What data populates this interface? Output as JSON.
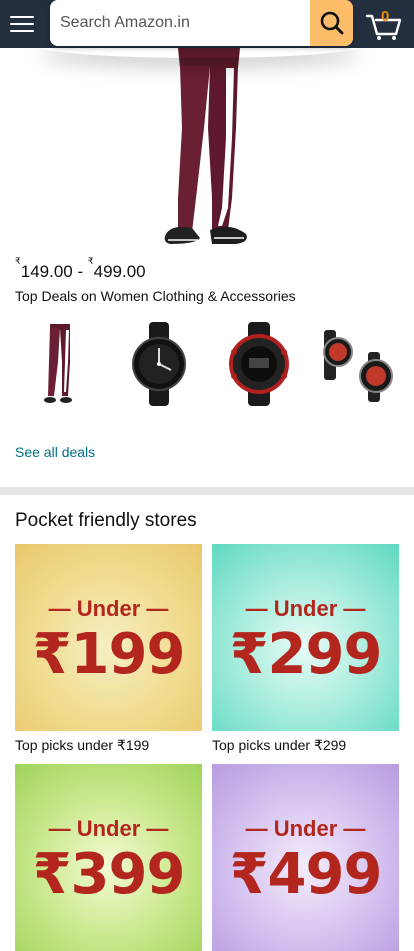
{
  "header": {
    "search_placeholder": "Search Amazon.in",
    "cart_count": "0"
  },
  "deal": {
    "price_symbol_low": "₹",
    "price_low": "149.00",
    "price_separator": "-",
    "price_symbol_high": "₹",
    "price_high": "499.00",
    "title": "Top Deals on Women Clothing & Accessories",
    "see_all": "See all deals"
  },
  "thumbnails": [
    {
      "icon": "leggings-icon"
    },
    {
      "icon": "watch-black-icon"
    },
    {
      "icon": "watch-digital-icon"
    },
    {
      "icon": "watch-pair-icon"
    }
  ],
  "stores": {
    "title": "Pocket friendly stores",
    "items": [
      {
        "banner_label": "— Under —",
        "banner_price": "₹199",
        "caption": "Top picks under ₹199",
        "color_from": "#f6efc4",
        "color_to": "#e9c86b"
      },
      {
        "banner_label": "— Under —",
        "banner_price": "₹299",
        "caption": "Top picks under ₹299",
        "color_from": "#e8fbf6",
        "color_to": "#5fd9c0"
      },
      {
        "banner_label": "— Under —",
        "banner_price": "₹399",
        "caption": "",
        "color_from": "#f3fbd4",
        "color_to": "#9fd35a"
      },
      {
        "banner_label": "— Under —",
        "banner_price": "₹499",
        "caption": "",
        "color_from": "#f4ecfb",
        "color_to": "#b79be0"
      }
    ]
  },
  "colors": {
    "header_bg": "#232f3e",
    "search_button": "#febd69",
    "link": "#007185",
    "cart_count": "#f08804",
    "banner_text": "#b3261e"
  }
}
